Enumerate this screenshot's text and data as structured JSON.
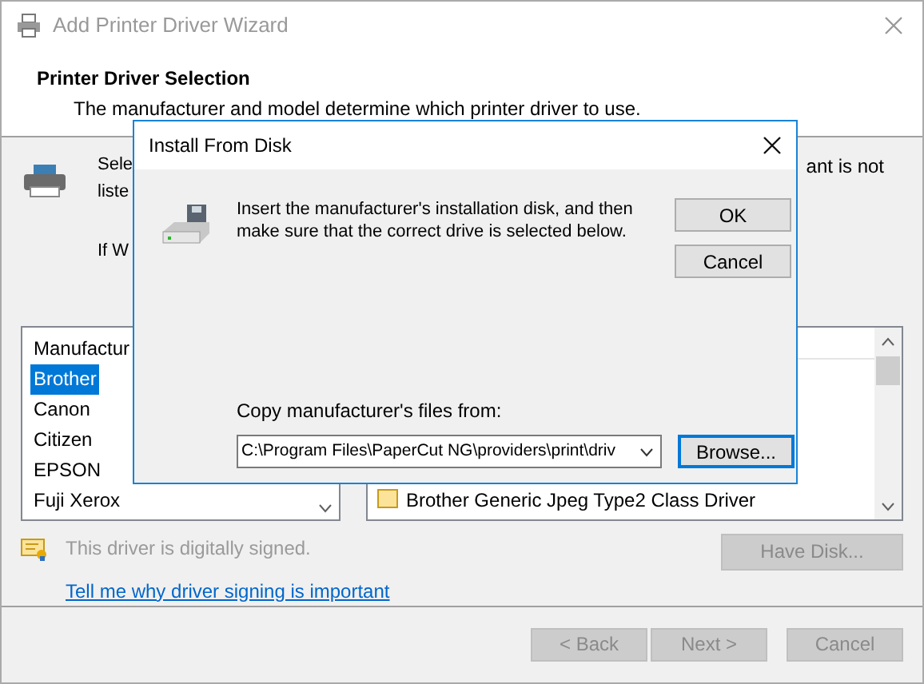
{
  "window": {
    "title": "Add Printer Driver Wizard"
  },
  "header": {
    "title": "Printer Driver Selection",
    "subtitle": "The manufacturer and model determine which printer driver to use."
  },
  "intro_fragments": {
    "line_1_left": "Sele",
    "line_1_right": "ant is not",
    "line_2_left": "liste",
    "line_3_left": "If W"
  },
  "manufacturers": {
    "header": "Manufactur",
    "items": [
      {
        "label": "Brother",
        "selected": true
      },
      {
        "label": "Canon",
        "selected": false
      },
      {
        "label": "Citizen",
        "selected": false
      },
      {
        "label": "EPSON",
        "selected": false
      },
      {
        "label": "Fuji Xerox",
        "selected": false
      }
    ]
  },
  "printers": {
    "items": [
      {
        "label": "Brother Generic Jpeg Type2 Class Driver"
      }
    ]
  },
  "signing": {
    "text": "This driver is digitally signed.",
    "link": "Tell me why driver signing is important"
  },
  "have_disk": {
    "label": "Have Disk...",
    "disabled": true
  },
  "nav_buttons": [
    {
      "label": "< Back",
      "disabled": true
    },
    {
      "label": "Next >",
      "disabled": true
    },
    {
      "label": "Cancel",
      "disabled": true
    }
  ],
  "dialog": {
    "title": "Install From Disk",
    "message": "Insert the manufacturer's installation disk, and then make sure that the correct drive is selected below.",
    "buttons": [
      {
        "label": "OK",
        "focused": false
      },
      {
        "label": "Cancel",
        "focused": false
      }
    ],
    "path_label": "Copy manufacturer's files from:",
    "path_value": "C:\\Program Files\\PaperCut NG\\providers\\print\\driv",
    "browse": {
      "label": "Browse...",
      "focused": true
    }
  }
}
